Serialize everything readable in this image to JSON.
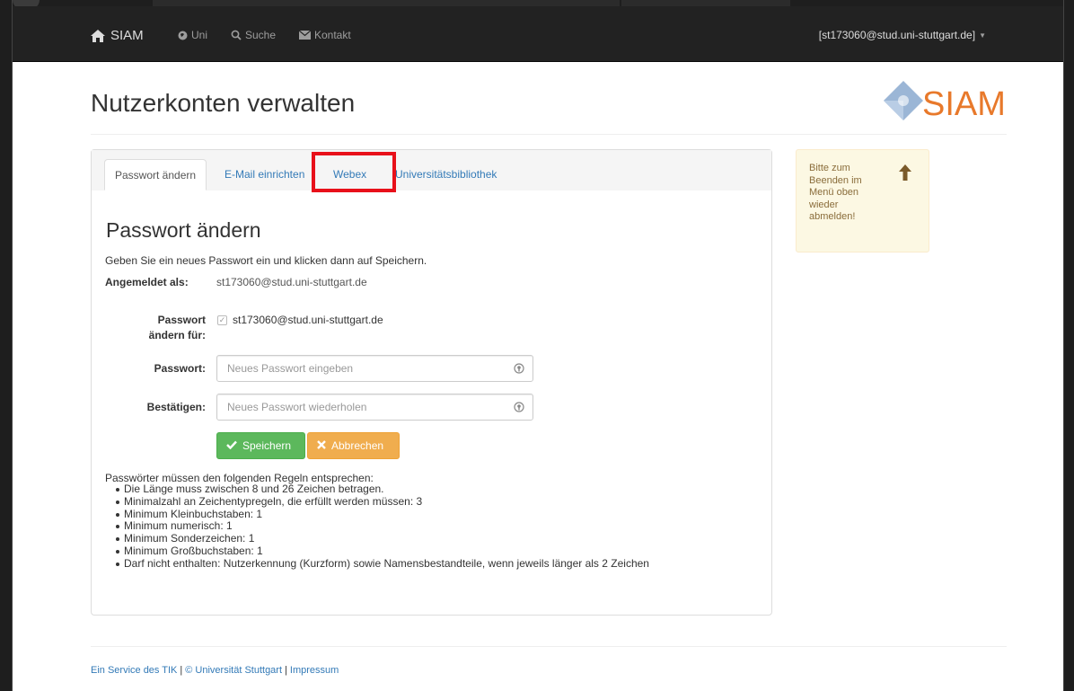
{
  "navbar": {
    "brand": "SIAM",
    "links": [
      {
        "label": "Uni",
        "icon": "globe-icon"
      },
      {
        "label": "Suche",
        "icon": "search-icon"
      },
      {
        "label": "Kontakt",
        "icon": "envelope-icon"
      }
    ],
    "user": "[st173060@stud.uni-stuttgart.de]"
  },
  "header": {
    "title": "Nutzerkonten verwalten",
    "logo_text": "SIAM"
  },
  "tabs": [
    {
      "label": "Passwort ändern",
      "active": true
    },
    {
      "label": "E-Mail einrichten",
      "active": false
    },
    {
      "label": "Webex",
      "active": false,
      "highlighted": true
    },
    {
      "label": "Universitätsbibliothek",
      "active": false
    }
  ],
  "form": {
    "heading": "Passwort ändern",
    "intro": "Geben Sie ein neues Passwort ein und klicken dann auf Speichern.",
    "logged_in_label": "Angemeldet als:",
    "logged_in_value": "st173060@stud.uni-stuttgart.de",
    "change_for_label_1": "Passwort",
    "change_for_label_2": "ändern für:",
    "change_for_value": "st173060@stud.uni-stuttgart.de",
    "password_label": "Passwort:",
    "password_placeholder": "Neues Passwort eingeben",
    "confirm_label": "Bestätigen:",
    "confirm_placeholder": "Neues Passwort wiederholen",
    "save_label": "Speichern",
    "cancel_label": "Abbrechen"
  },
  "rules": {
    "intro": "Passwörter müssen den folgenden Regeln entsprechen:",
    "items": [
      "Die Länge muss zwischen 8 und 26 Zeichen betragen.",
      "Minimalzahl an Zeichentypregeln, die erfüllt werden müssen: 3",
      "Minimum Kleinbuchstaben: 1",
      "Minimum numerisch: 1",
      "Minimum Sonderzeichen: 1",
      "Minimum Großbuchstaben: 1",
      "Darf nicht enthalten: Nutzerkennung (Kurzform) sowie Namensbestandteile, wenn jeweils länger als 2 Zeichen"
    ]
  },
  "notice": {
    "text": "Bitte zum Beenden im Menü oben wieder abmelden!",
    "icon": "arrow-up-icon"
  },
  "footer": {
    "service": "Ein Service des TIK",
    "copyright": "© Universität Stuttgart",
    "imprint": "Impressum"
  },
  "colors": {
    "navbar_bg": "#222222",
    "link": "#337ab7",
    "save_button": "#5cb85c",
    "cancel_button": "#f0ad4e",
    "highlight_box": "#e8101a",
    "notice_bg": "#fcf8e3",
    "logo_orange": "#e8792b"
  }
}
